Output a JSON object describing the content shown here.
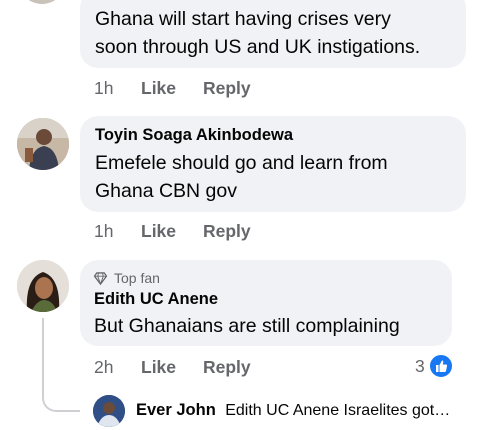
{
  "comments": [
    {
      "author": "",
      "lines": [
        "Ghana will start having crises very",
        "soon through US and UK instigations."
      ],
      "time": "1h",
      "like": "Like",
      "reply": "Reply"
    },
    {
      "author": "Toyin Soaga Akinbodewa",
      "lines": [
        "Emefele should go and learn from",
        "Ghana CBN gov"
      ],
      "time": "1h",
      "like": "Like",
      "reply": "Reply"
    },
    {
      "badge": "Top fan",
      "author": "Edith UC Anene",
      "lines": [
        "But Ghanaians are still complaining"
      ],
      "time": "2h",
      "like": "Like",
      "reply": "Reply",
      "reactions": "3"
    }
  ],
  "reply_preview": {
    "author": "Ever John",
    "text": "Edith UC Anene Israelites got…"
  },
  "colors": {
    "bubble": "#f0f2f5",
    "meta_text": "#65676b",
    "like_blue": "#1877f2"
  },
  "icons": [
    "top-fan-diamond-icon",
    "like-thumb-icon"
  ]
}
